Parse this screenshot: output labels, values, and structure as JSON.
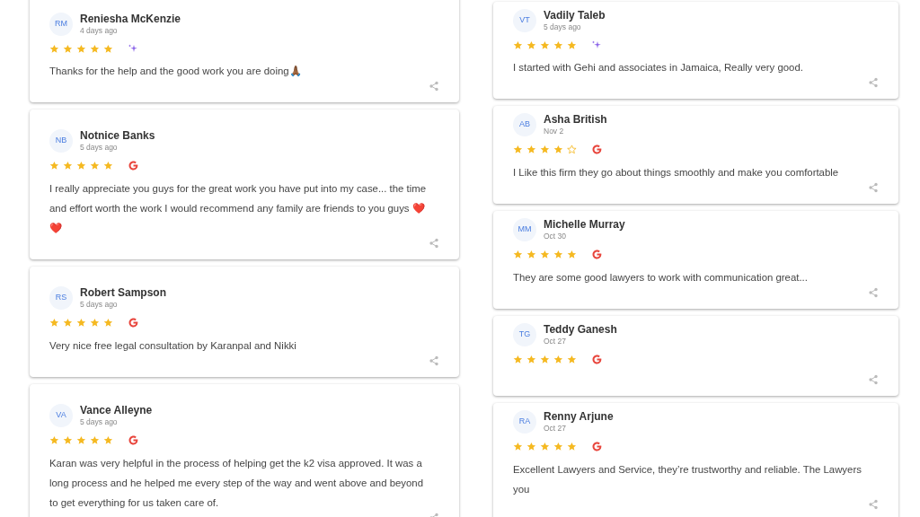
{
  "columns": [
    {
      "reviews": [
        {
          "initials": "RM",
          "name": "Reniesha McKenzie",
          "date": "4 days ago",
          "stars": 5,
          "kind": "sparkle",
          "text": "Thanks for the help and the good work you are doing🙏🏾"
        },
        {
          "initials": "NB",
          "name": "Notnice Banks",
          "date": "5 days ago",
          "stars": 5,
          "kind": "google",
          "text": "I really appreciate you guys for the great work you have put into my case... the time and effort worth the work I would recommend any family are friends to you guys ❤️❤️"
        },
        {
          "initials": "RS",
          "name": "Robert Sampson",
          "date": "5 days ago",
          "stars": 5,
          "kind": "google",
          "text": "Very nice free legal consultation by Karanpal and Nikki"
        },
        {
          "initials": "VA",
          "name": "Vance Alleyne",
          "date": "5 days ago",
          "stars": 5,
          "kind": "google",
          "text": "Karan was very helpful in the process of helping get the k2 visa approved. It was a long process and he helped me every step of the way and went above and beyond to get everything for us taken care of."
        }
      ]
    },
    {
      "reviews": [
        {
          "initials": "VT",
          "name": "Vadily Taleb",
          "date": "5 days ago",
          "stars": 5,
          "kind": "sparkle",
          "text": "I started with Gehi and associates in Jamaica, Really very good."
        },
        {
          "initials": "AB",
          "name": "Asha British",
          "date": "Nov 2",
          "stars": 4,
          "kind": "google",
          "text": "I Like this firm they go about things smoothly and make you comfortable"
        },
        {
          "initials": "MM",
          "name": "Michelle Murray",
          "date": "Oct 30",
          "stars": 5,
          "kind": "google",
          "text": "They are some good lawyers to work with communication great..."
        },
        {
          "initials": "TG",
          "name": "Teddy Ganesh",
          "date": "Oct 27",
          "stars": 5,
          "kind": "google"
        },
        {
          "initials": "RA",
          "name": "Renny Arjune",
          "date": "Oct 27",
          "stars": 5,
          "kind": "google",
          "text": "Excellent Lawyers and Service, they’re trustworthy and reliable. The Lawyers you"
        }
      ]
    }
  ]
}
